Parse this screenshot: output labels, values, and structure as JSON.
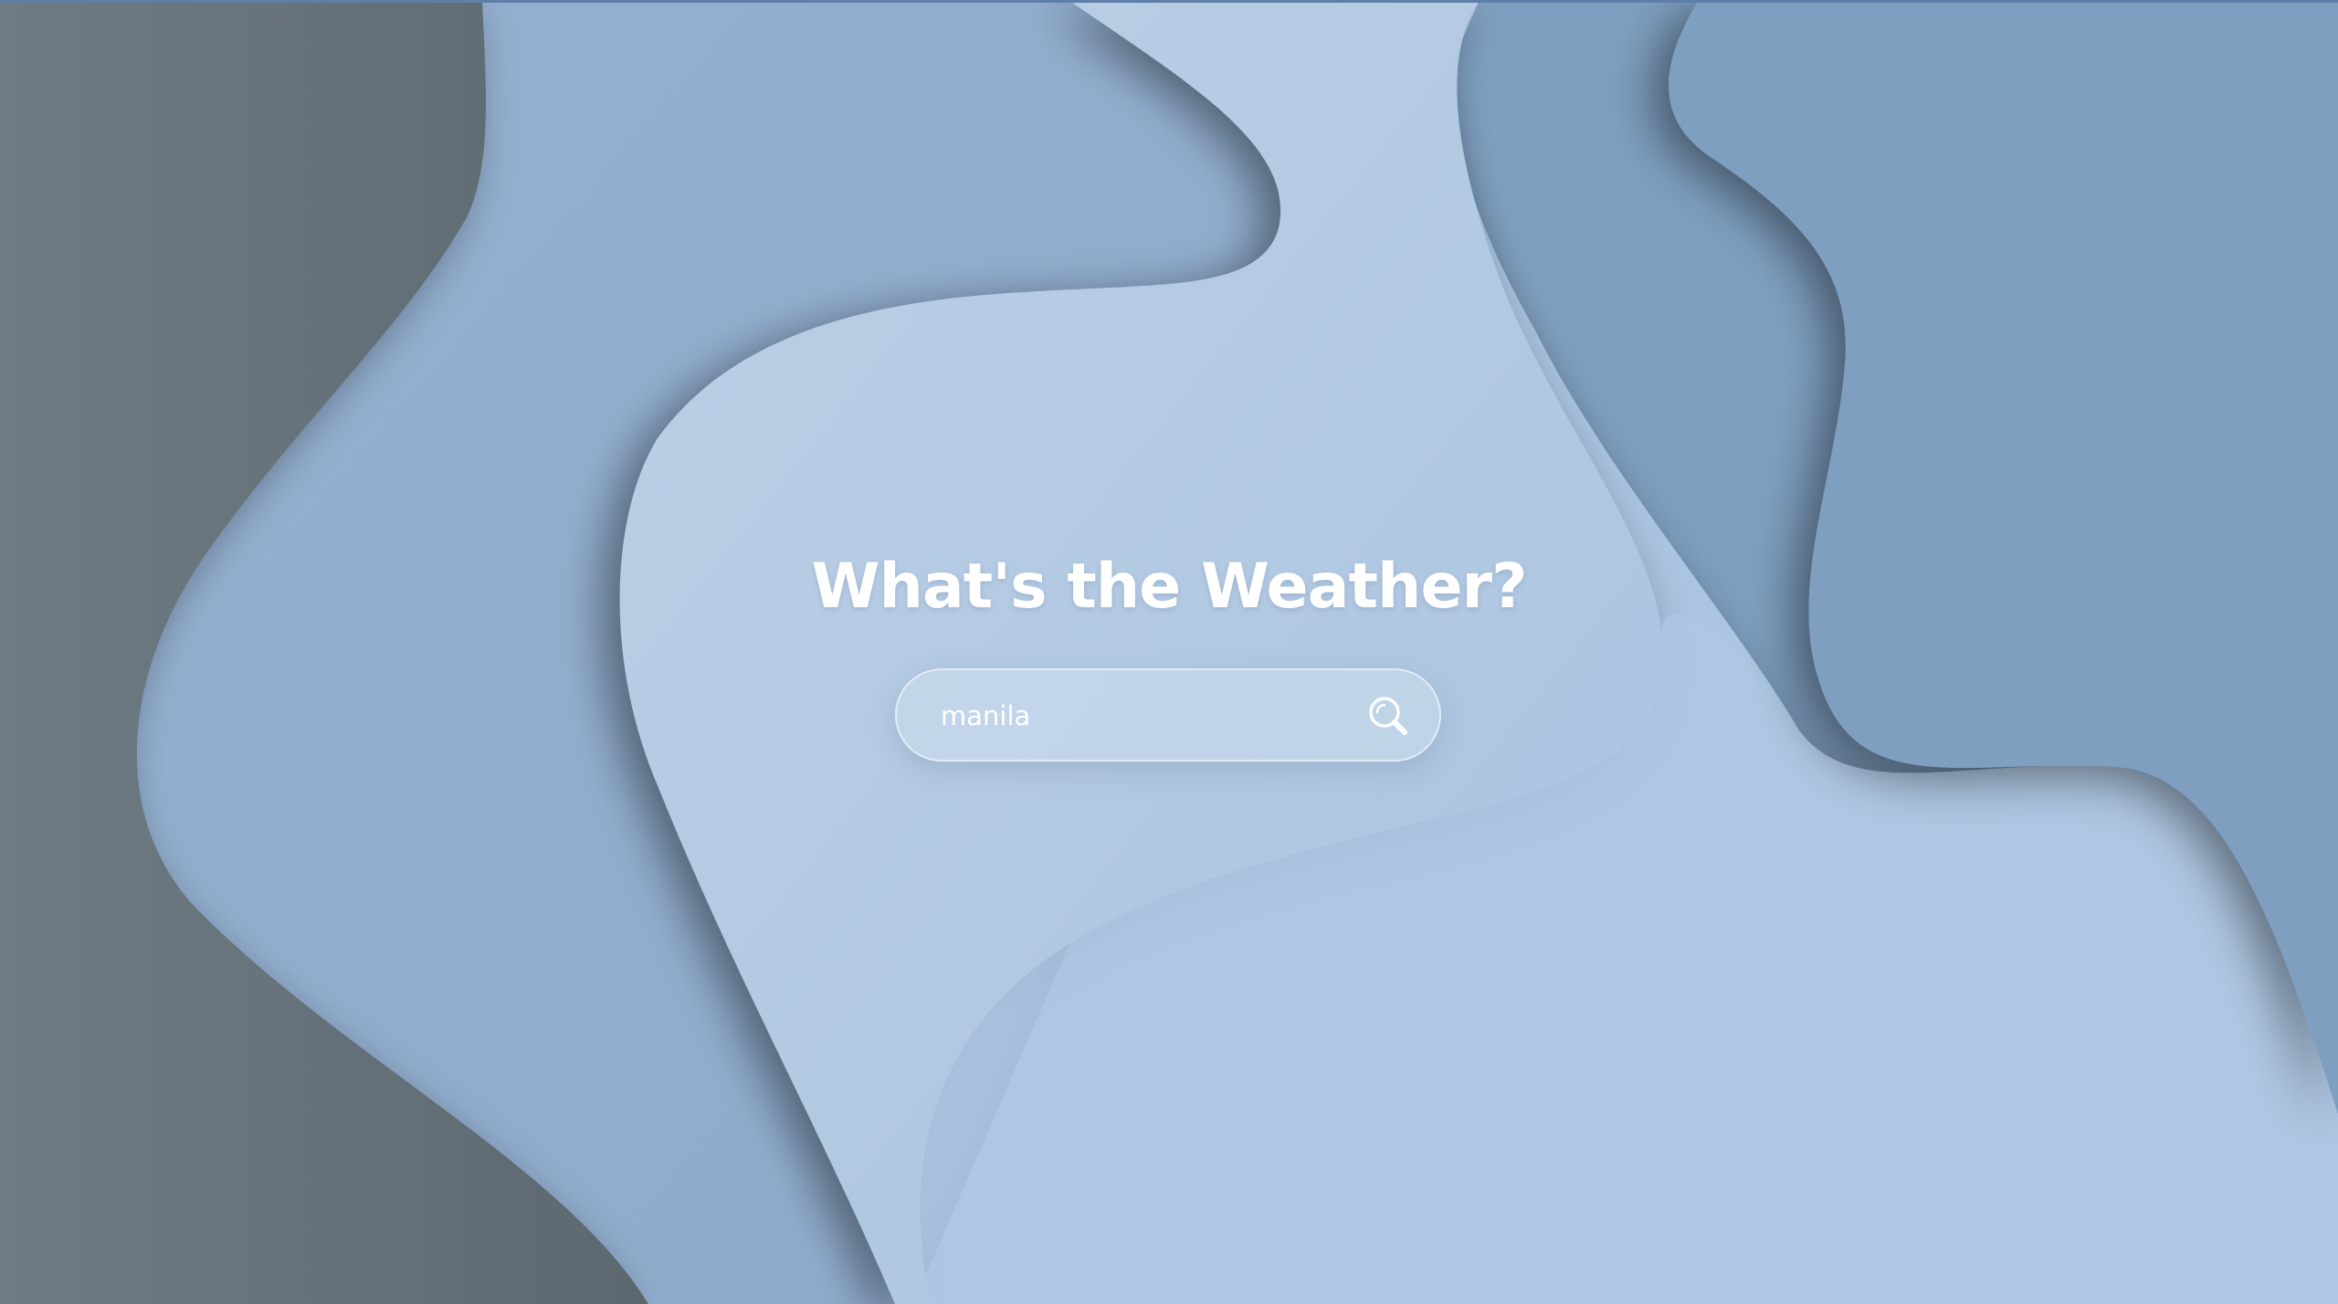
{
  "app": {
    "heading": "What's the Weather?"
  },
  "search": {
    "value": "manila",
    "icon": "search-icon"
  },
  "colors": {
    "background_dark": "#6f7b84",
    "background_mid": "#98b4d3",
    "background_light": "#b8cee4",
    "background_right": "#7f9fc0",
    "text": "#ffffff"
  }
}
